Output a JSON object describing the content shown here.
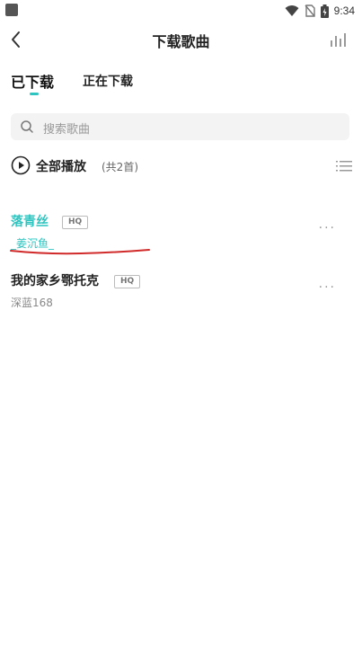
{
  "status_bar": {
    "time": "9:34"
  },
  "header": {
    "title": "下载歌曲"
  },
  "tabs": [
    {
      "label": "已下载",
      "active": true
    },
    {
      "label": "正在下载",
      "active": false
    }
  ],
  "search": {
    "placeholder": "搜索歌曲"
  },
  "play_all": {
    "label": "全部播放",
    "count": "(共2首)"
  },
  "songs": [
    {
      "title": "落青丝",
      "quality": "HQ",
      "artist": "_姜沉鱼_",
      "playing": true
    },
    {
      "title": "我的家乡鄂托克",
      "quality": "HQ",
      "artist": "深蓝168",
      "playing": false
    }
  ],
  "colors": {
    "accent": "#2ec4c0",
    "annotation": "#d12a2a"
  },
  "icons": [
    "back-icon",
    "equalizer-icon",
    "search-icon",
    "play-circle-icon",
    "list-icon",
    "more-icon",
    "wifi-icon",
    "no-sim-icon",
    "battery-icon"
  ]
}
